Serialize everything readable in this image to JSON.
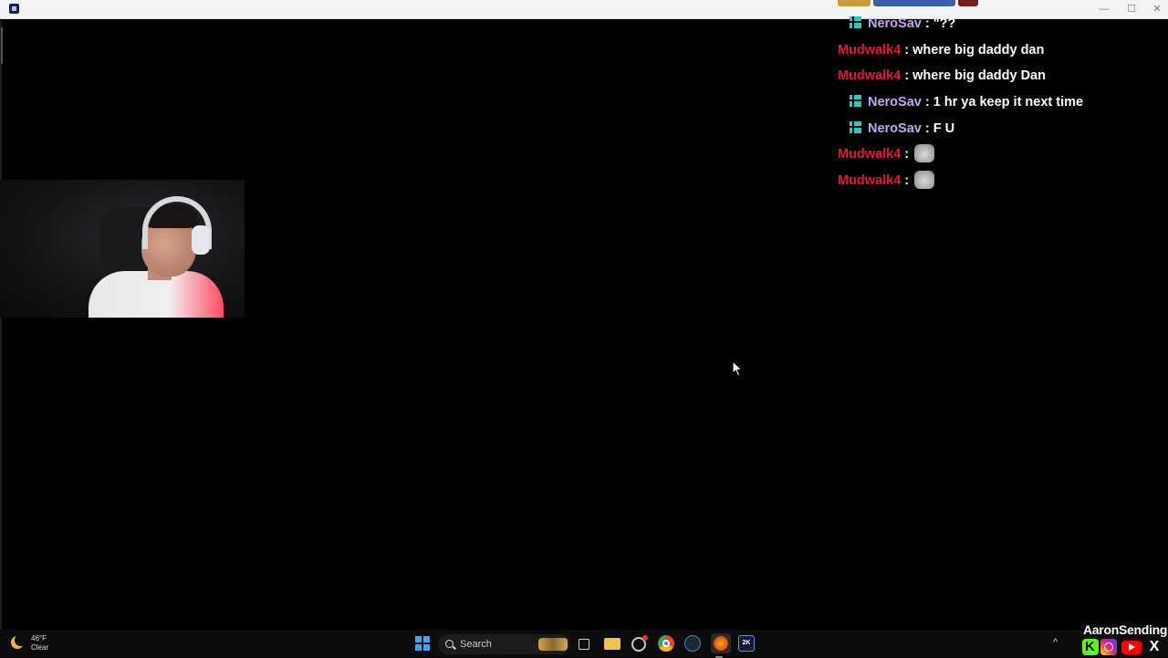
{
  "window": {
    "controls": {
      "minimize": "—",
      "maximize": "☐",
      "close": "✕"
    }
  },
  "chat": {
    "colors": {
      "mudwalk": "#e4163a",
      "nerosav": "#c7a4f2",
      "message": "#ffffff",
      "badge": "#26c9c3"
    },
    "lines": [
      {
        "user": "NeroSav",
        "badge": true,
        "sep": ":",
        "message": "\"??"
      },
      {
        "user": "Mudwalk4",
        "badge": false,
        "sep": ":",
        "message": "where big daddy dan"
      },
      {
        "user": "Mudwalk4",
        "badge": false,
        "sep": ":",
        "message": "where big daddy Dan"
      },
      {
        "user": "NeroSav",
        "badge": true,
        "sep": ":",
        "message": "1 hr ya keep it next time"
      },
      {
        "user": "NeroSav",
        "badge": true,
        "sep": ":",
        "message": "F U"
      },
      {
        "user": "Mudwalk4",
        "badge": false,
        "sep": ":",
        "message": "",
        "emote": "cat-emote"
      },
      {
        "user": "Mudwalk4",
        "badge": false,
        "sep": ":",
        "message": "",
        "emote": "cat-emote"
      }
    ]
  },
  "taskbar": {
    "weather": {
      "temp": "46°F",
      "condition": "Clear",
      "icon": "moon-icon"
    },
    "search_label": "Search",
    "apps": [
      "task-view-icon",
      "file-explorer-icon",
      "ring-app-icon",
      "chrome-icon",
      "steam-icon",
      "obs-icon",
      "nba2k-icon"
    ],
    "twok_label": "2K"
  },
  "tray": {
    "chevron": "^"
  },
  "overlay": {
    "streamer": "AaronSending",
    "socials": [
      "kick-icon",
      "instagram-icon",
      "youtube-icon",
      "x-icon"
    ],
    "x_glyph": "X"
  }
}
